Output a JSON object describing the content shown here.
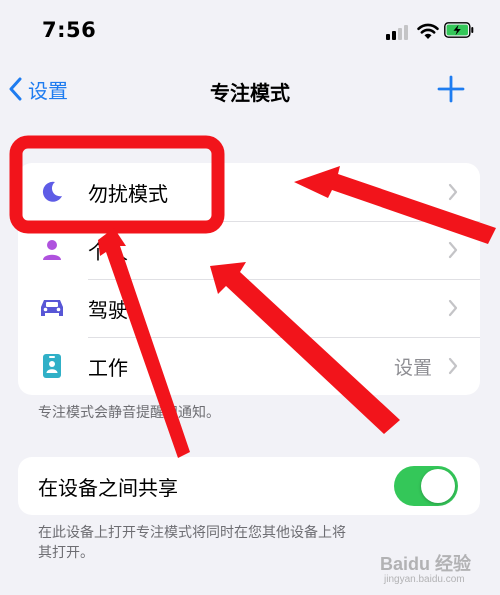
{
  "status_bar": {
    "time": "7:56"
  },
  "nav": {
    "back_label": "设置",
    "title": "专注模式"
  },
  "focus_list": {
    "items": [
      {
        "label": "勿扰模式",
        "icon": "moon-icon",
        "color": "#5e5ce6",
        "value": ""
      },
      {
        "label": "个人",
        "icon": "person-icon",
        "color": "#af52de",
        "value": ""
      },
      {
        "label": "驾驶",
        "icon": "car-icon",
        "color": "#5856d6",
        "value": ""
      },
      {
        "label": "工作",
        "icon": "id-badge-icon",
        "color": "#30b0c7",
        "value": "设置"
      }
    ],
    "footnote": "专注模式会静音提醒和通知。"
  },
  "share": {
    "label": "在设备之间共享",
    "enabled": true,
    "footnote_line1": "在此设备上打开专注模式将同时在您其他设备上将",
    "footnote_line2": "其打开。"
  },
  "watermark": {
    "brand": "Baidu 经验",
    "url": "jingyan.baidu.com"
  },
  "colors": {
    "accent": "#1e7cf0",
    "toggle_on": "#34c759",
    "annotation": "#f2141b"
  }
}
